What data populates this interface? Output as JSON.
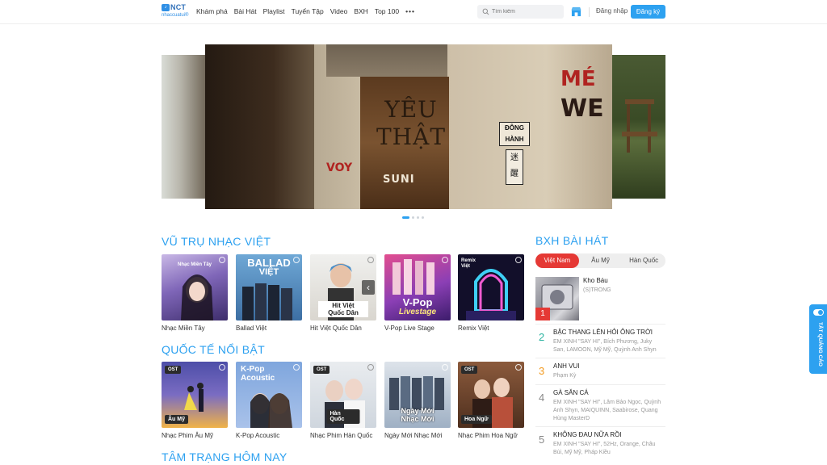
{
  "header": {
    "logo_text": "NCT",
    "logo_badge": "♪",
    "logo_sub": "nhaccuatui®",
    "nav": [
      "Khám phá",
      "Bài Hát",
      "Playlist",
      "Tuyển Tập",
      "Video",
      "BXH",
      "Top 100"
    ],
    "more": "•••",
    "search_placeholder": "Tìm kiếm",
    "login_label": "Đăng nhập",
    "signup_label": "Đăng ký"
  },
  "banner": {
    "title": "YÊU THẬT",
    "brand": "SUNI",
    "sign_text": "ĐÔNG HÀNH",
    "sign2_text": "迷 醒",
    "scribble_me": "MÉ",
    "scribble_we": "WE",
    "scribble_voy": "VOY",
    "slides": 4,
    "active_slide": 1
  },
  "sections": {
    "vietnam": {
      "title": "VŨ TRỤ NHẠC VIỆT",
      "items": [
        {
          "label": "Nhạc Miền Tây",
          "cover_text": "Nhạc Miền Tây"
        },
        {
          "label": "Ballad Việt",
          "cover_text": "BALLAD",
          "cover_text2": "VIỆT"
        },
        {
          "label": "Hit Việt Quốc Dân",
          "cover_text": "Hit Việt",
          "cover_text2": "Quốc Dân"
        },
        {
          "label": "V-Pop Live Stage",
          "cover_text": "V-Pop",
          "cover_text2": "Livestage"
        },
        {
          "label": "Remix Việt",
          "cover_text": "Remix",
          "cover_text2": "Việt"
        }
      ]
    },
    "international": {
      "title": "QUỐC TẾ NỔI BẬT",
      "items": [
        {
          "label": "Nhạc Phim Âu Mỹ",
          "ost": "OST",
          "pill": "Âu Mỹ"
        },
        {
          "label": "K-Pop Acoustic",
          "cover_text": "K-Pop",
          "cover_text2": "Acoustic"
        },
        {
          "label": "Nhạc Phim Hàn Quốc",
          "ost": "OST",
          "pill": "Hàn Quốc"
        },
        {
          "label": "Ngày Mới Nhạc Mới",
          "cover_text": "Ngày Mới",
          "cover_text2": "Nhạc Mới"
        },
        {
          "label": "Nhạc Phim Hoa Ngữ",
          "ost": "OST",
          "pill": "Hoa Ngữ"
        }
      ]
    },
    "mood": {
      "title": "TÂM TRẠNG HÔM NAY"
    }
  },
  "chart": {
    "title": "BXH BÀI HÁT",
    "tabs": [
      "Việt Nam",
      "Âu Mỹ",
      "Hàn Quốc"
    ],
    "active_tab": 0,
    "top": {
      "rank": "1",
      "name": "Kho Báu",
      "artist": "(S)TRONG"
    },
    "items": [
      {
        "rank": "2",
        "name": "BẬC THANG LÊN HỎI ÔNG TRỜI",
        "artists": "EM XINH \"SAY HI\", Bích Phương, Juky San, LAMOON, Mỹ Mỹ, Quỳnh Anh Shyn",
        "color": "#2bb3a0"
      },
      {
        "rank": "3",
        "name": "ANH VUI",
        "artists": "Phạm Kỳ",
        "color": "#f29a1f"
      },
      {
        "rank": "4",
        "name": "GÀ SĂN CÁ",
        "artists": "EM XINH \"SAY HI\", Lâm Bảo Ngọc, Quỳnh Anh Shyn, MAIQUINN, Saabirose, Quang Hùng MasterD",
        "color": "#888888"
      },
      {
        "rank": "5",
        "name": "KHÔNG ĐAU NỮA RỒI",
        "artists": "EM XINH \"SAY HI\", 52Hz, Orange, Châu Bùi, Mỹ Mỹ, Pháp Kiều",
        "color": "#888888"
      }
    ]
  },
  "ad_tab": {
    "label": "TẮT QUẢNG CÁO"
  },
  "colors": {
    "accent": "#2da1f0",
    "chart_active": "#e53935"
  }
}
